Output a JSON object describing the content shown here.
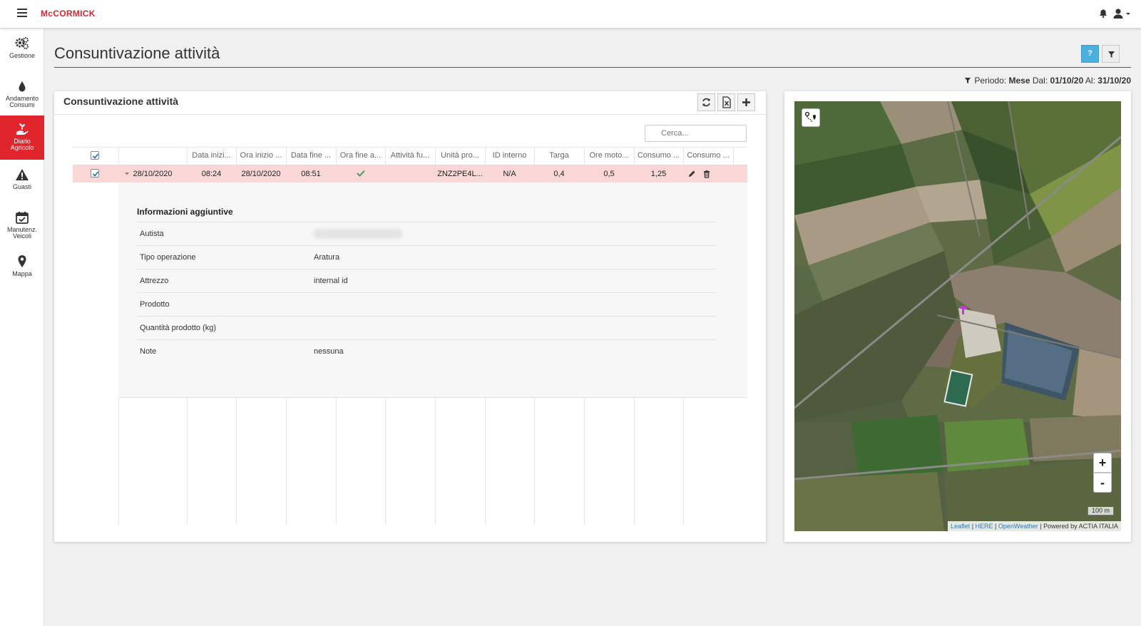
{
  "app": {
    "brand": "McCORMICK",
    "brand_color": "#d7262f"
  },
  "sidebar": {
    "items": [
      {
        "label": "Gestione",
        "icon": "gears-icon",
        "active": false
      },
      {
        "label": "Andamento Consumi",
        "icon": "drop-icon",
        "active": false
      },
      {
        "label": "Diario Agricolo",
        "icon": "plant-hand-icon",
        "active": true
      },
      {
        "label": "Guasti",
        "icon": "warning-icon",
        "active": false
      },
      {
        "label": "Manutenz. Veicoli",
        "icon": "calendar-check-icon",
        "active": false
      },
      {
        "label": "Mappa",
        "icon": "map-pin-icon",
        "active": false
      }
    ],
    "active_color": "#e0262c"
  },
  "page": {
    "title": "Consuntivazione attività",
    "help_label": "?",
    "period": {
      "prefix": "Periodo:",
      "mode": "Mese",
      "from_label": "Dal:",
      "from": "01/10/20",
      "to_label": "Al:",
      "to": "31/10/20"
    }
  },
  "panel": {
    "title": "Consuntivazione attività",
    "search_placeholder": "Cerca...",
    "columns": [
      "Data inizi...",
      "Ora inizio ...",
      "Data fine ...",
      "Ora fine a...",
      "Attività fu...",
      "Unità pro...",
      "ID interno",
      "Targa",
      "Ore moto...",
      "Consumo ...",
      "Consumo ..."
    ],
    "row": {
      "data_inizio": "28/10/2020",
      "ora_inizio": "08:24",
      "data_fine": "28/10/2020",
      "ora_fine": "08:51",
      "attivita_completed": true,
      "unita": "",
      "id_interno": "ZNZ2PE4L...",
      "targa": "N/A",
      "ore_moto": "0,4",
      "consumo1": "0,5",
      "consumo2": "1,25"
    },
    "details": {
      "title": "Informazioni aggiuntive",
      "rows": [
        {
          "key": "Autista",
          "value": ""
        },
        {
          "key": "Tipo operazione",
          "value": "Aratura"
        },
        {
          "key": "Attrezzo",
          "value": "internal id"
        },
        {
          "key": "Prodotto",
          "value": ""
        },
        {
          "key": "Quantità prodotto (kg)",
          "value": ""
        },
        {
          "key": "Note",
          "value": "nessuna"
        }
      ]
    }
  },
  "map": {
    "zoom_in": "+",
    "zoom_out": "-",
    "scale": "100 m",
    "attribution": {
      "leaflet": "Leaflet",
      "here": "HERE",
      "openweather": "OpenWeather",
      "powered": "Powered by ACTIA ITALIA"
    }
  }
}
